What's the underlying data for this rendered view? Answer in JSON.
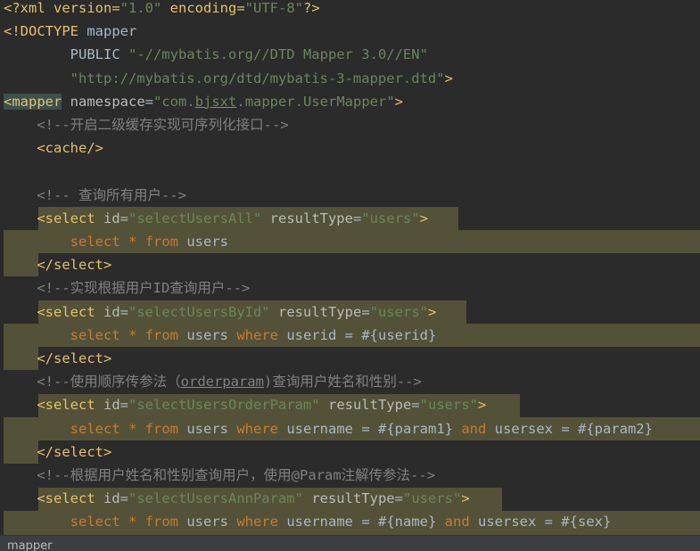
{
  "lines": [
    {
      "segs": [
        [
          "pi",
          "<?xml version="
        ],
        [
          "av",
          "\"1.0\""
        ],
        [
          "pi",
          " encoding="
        ],
        [
          "av",
          "\"UTF-8\""
        ],
        [
          "pi",
          "?>"
        ]
      ]
    },
    {
      "segs": [
        [
          "t",
          "<!DOCTYPE "
        ],
        [
          "tx",
          "mapper"
        ]
      ]
    },
    {
      "segs": [
        [
          "tx",
          "        PUBLIC "
        ],
        [
          "av",
          "\"-//mybatis.org//DTD Mapper 3.0//EN\""
        ]
      ]
    },
    {
      "segs": [
        [
          "tx",
          "        "
        ],
        [
          "av",
          "\"http://mybatis.org/dtd/mybatis-3-mapper.dtd\""
        ],
        [
          "t",
          ">"
        ]
      ]
    },
    {
      "segs": [
        [
          "t tag-hl",
          "<mapper"
        ],
        [
          "tx",
          " "
        ],
        [
          "an",
          "namespace"
        ],
        [
          "tx",
          "="
        ],
        [
          "av",
          "\"com."
        ],
        [
          "av ul",
          "bjsxt"
        ],
        [
          "av",
          ".mapper.UserMapper\""
        ],
        [
          "t",
          ">"
        ]
      ]
    },
    {
      "segs": [
        [
          "cm",
          "    <!--开启二级缓存实现可序列化接口-->"
        ]
      ]
    },
    {
      "segs": [
        [
          "t",
          "    <cache/>"
        ]
      ]
    },
    {
      "segs": [
        [
          "tx",
          ""
        ]
      ]
    },
    {
      "segs": [
        [
          "cm",
          "    <!-- 查询所有用户-->"
        ]
      ]
    },
    {
      "segs": [
        [
          "t",
          "    <select "
        ],
        [
          "an",
          "id"
        ],
        [
          "tx",
          "="
        ],
        [
          "av",
          "\"selectUsersAll\""
        ],
        [
          "tx",
          " "
        ],
        [
          "an",
          "resultType"
        ],
        [
          "tx",
          "="
        ],
        [
          "av",
          "\"users\""
        ],
        [
          "t",
          ">"
        ]
      ]
    },
    {
      "segs": [
        [
          "tx",
          "        "
        ],
        [
          "kw",
          "select"
        ],
        [
          "tx",
          " "
        ],
        [
          "kw",
          "*"
        ],
        [
          "tx",
          " "
        ],
        [
          "kw",
          "from"
        ],
        [
          "tx",
          " users"
        ]
      ]
    },
    {
      "segs": [
        [
          "t",
          "    </select>"
        ]
      ]
    },
    {
      "segs": [
        [
          "cm",
          "    <!--实现根据用户ID查询用户-->"
        ]
      ]
    },
    {
      "segs": [
        [
          "t",
          "    <select "
        ],
        [
          "an",
          "id"
        ],
        [
          "tx",
          "="
        ],
        [
          "av",
          "\"selectUsersById\""
        ],
        [
          "tx",
          " "
        ],
        [
          "an",
          "resultType"
        ],
        [
          "tx",
          "="
        ],
        [
          "av",
          "\"users\""
        ],
        [
          "t",
          ">"
        ]
      ]
    },
    {
      "segs": [
        [
          "tx",
          "        "
        ],
        [
          "kw",
          "select"
        ],
        [
          "tx",
          " "
        ],
        [
          "kw",
          "*"
        ],
        [
          "tx",
          " "
        ],
        [
          "kw",
          "from"
        ],
        [
          "tx",
          " users "
        ],
        [
          "kw",
          "where"
        ],
        [
          "tx",
          " userid = #{userid}"
        ]
      ]
    },
    {
      "segs": [
        [
          "t",
          "    </select>"
        ]
      ]
    },
    {
      "segs": [
        [
          "cm",
          "    <!--使用顺序传参法（"
        ],
        [
          "cm ul",
          "orderparam"
        ],
        [
          "cm",
          ")查询用户姓名和性别-->"
        ]
      ]
    },
    {
      "segs": [
        [
          "t",
          "    <select "
        ],
        [
          "an",
          "id"
        ],
        [
          "tx",
          "="
        ],
        [
          "av",
          "\"selectUsersOrderParam\""
        ],
        [
          "tx",
          " "
        ],
        [
          "an",
          "resultType"
        ],
        [
          "tx",
          "="
        ],
        [
          "av",
          "\"users\""
        ],
        [
          "t",
          ">"
        ]
      ]
    },
    {
      "segs": [
        [
          "tx",
          "        "
        ],
        [
          "kw",
          "select"
        ],
        [
          "tx",
          " "
        ],
        [
          "kw",
          "*"
        ],
        [
          "tx",
          " "
        ],
        [
          "kw",
          "from"
        ],
        [
          "tx",
          " users "
        ],
        [
          "kw",
          "where"
        ],
        [
          "tx",
          " username = #{param1} "
        ],
        [
          "kw",
          "and"
        ],
        [
          "tx",
          " usersex = #{param2}"
        ]
      ]
    },
    {
      "segs": [
        [
          "t",
          "    </select>"
        ]
      ]
    },
    {
      "segs": [
        [
          "cm",
          "    <!--根据用户姓名和性别查询用户，使用@Param注解传参法-->"
        ]
      ]
    },
    {
      "segs": [
        [
          "t",
          "    <select "
        ],
        [
          "an",
          "id"
        ],
        [
          "tx",
          "="
        ],
        [
          "av",
          "\"selectUsersAnnParam\""
        ],
        [
          "tx",
          " "
        ],
        [
          "an",
          "resultType"
        ],
        [
          "tx",
          "="
        ],
        [
          "av",
          "\"users\""
        ],
        [
          "t",
          ">"
        ]
      ]
    },
    {
      "segs": [
        [
          "tx",
          "        "
        ],
        [
          "kw",
          "select"
        ],
        [
          "tx",
          " "
        ],
        [
          "kw",
          "*"
        ],
        [
          "tx",
          " "
        ],
        [
          "kw",
          "from"
        ],
        [
          "tx",
          " users "
        ],
        [
          "kw",
          "where"
        ],
        [
          "tx",
          " username = #{name} "
        ],
        [
          "kw",
          "and"
        ],
        [
          "tx",
          " usersex = #{sex}"
        ]
      ]
    }
  ],
  "statusbar": {
    "breadcrumb": "mapper"
  },
  "colors": {
    "background": "#2b2b2b",
    "tag": "#e8bf6a",
    "attribute_value": "#6a8759",
    "comment": "#808080",
    "sql_keyword": "#cc7832",
    "block_highlight": "#535238",
    "tag_match_highlight": "#3b514d"
  }
}
